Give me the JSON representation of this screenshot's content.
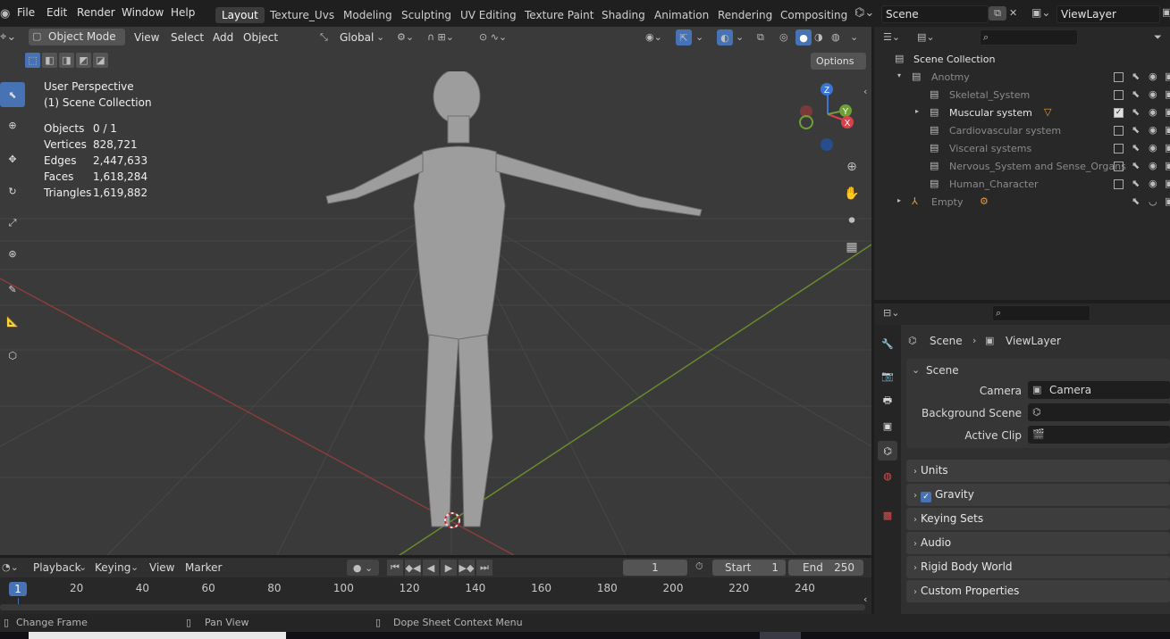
{
  "topbar": {
    "menus": [
      "File",
      "Edit",
      "Render",
      "Window",
      "Help"
    ],
    "workspaces": [
      "Layout",
      "Texture_Uvs",
      "Modeling",
      "Sculpting",
      "UV Editing",
      "Texture Paint",
      "Shading",
      "Animation",
      "Rendering",
      "Compositing"
    ],
    "active_workspace": "Layout",
    "scene": "Scene",
    "view_layer": "ViewLayer"
  },
  "viewport": {
    "mode": "Object Mode",
    "menus": [
      "View",
      "Select",
      "Add",
      "Object"
    ],
    "orientation": "Global",
    "options_label": "Options",
    "overlay": {
      "title": "User Perspective",
      "collection": "(1) Scene Collection"
    },
    "stats": [
      {
        "label": "Objects",
        "value": "0 / 1"
      },
      {
        "label": "Vertices",
        "value": "828,721"
      },
      {
        "label": "Edges",
        "value": "2,447,633"
      },
      {
        "label": "Faces",
        "value": "1,618,284"
      },
      {
        "label": "Triangles",
        "value": "1,619,882"
      }
    ],
    "gizmo": {
      "z": "Z",
      "y": "Y",
      "x": "X"
    }
  },
  "outliner": {
    "root": "Scene Collection",
    "items": [
      {
        "name": "Anotmy",
        "indent": 1,
        "dim": true,
        "checked": false
      },
      {
        "name": "Skeletal_System",
        "indent": 2,
        "dim": true,
        "checked": false
      },
      {
        "name": "Muscular system",
        "indent": 2,
        "dim": false,
        "checked": true
      },
      {
        "name": "Cardiovascular system",
        "indent": 2,
        "dim": true,
        "checked": false
      },
      {
        "name": "Visceral systems",
        "indent": 2,
        "dim": true,
        "checked": false
      },
      {
        "name": "Nervous_System and Sense_Organs",
        "indent": 2,
        "dim": true,
        "checked": false
      },
      {
        "name": "Human_Character",
        "indent": 2,
        "dim": true,
        "checked": false
      },
      {
        "name": "Empty",
        "indent": 1,
        "dim": true,
        "checked": false
      }
    ]
  },
  "properties": {
    "breadcrumb_scene": "Scene",
    "breadcrumb_layer": "ViewLayer",
    "section": "Scene",
    "fields": [
      {
        "label": "Camera",
        "value": "Camera"
      },
      {
        "label": "Background Scene",
        "value": ""
      },
      {
        "label": "Active Clip",
        "value": ""
      }
    ],
    "panels": [
      "Units",
      "Gravity",
      "Keying Sets",
      "Audio",
      "Rigid Body World",
      "Custom Properties"
    ],
    "gravity_checked": true
  },
  "timeline": {
    "menus": [
      "Playback",
      "Keying",
      "View",
      "Marker"
    ],
    "current_frame": "1",
    "start_label": "Start",
    "start": "1",
    "end_label": "End",
    "end": "250",
    "ruler": [
      "1",
      "20",
      "40",
      "60",
      "80",
      "100",
      "120",
      "140",
      "160",
      "180",
      "200",
      "220",
      "240"
    ]
  },
  "status": {
    "items": [
      "Change Frame",
      "Pan View",
      "Dope Sheet Context Menu"
    ]
  },
  "colors": {
    "accent": "#4772b3",
    "x_axis": "#c04545",
    "y_axis": "#7a9a3a",
    "gizmo_z": "#3b76d6",
    "gizmo_y": "#6ea036",
    "gizmo_x": "#d8404b"
  }
}
